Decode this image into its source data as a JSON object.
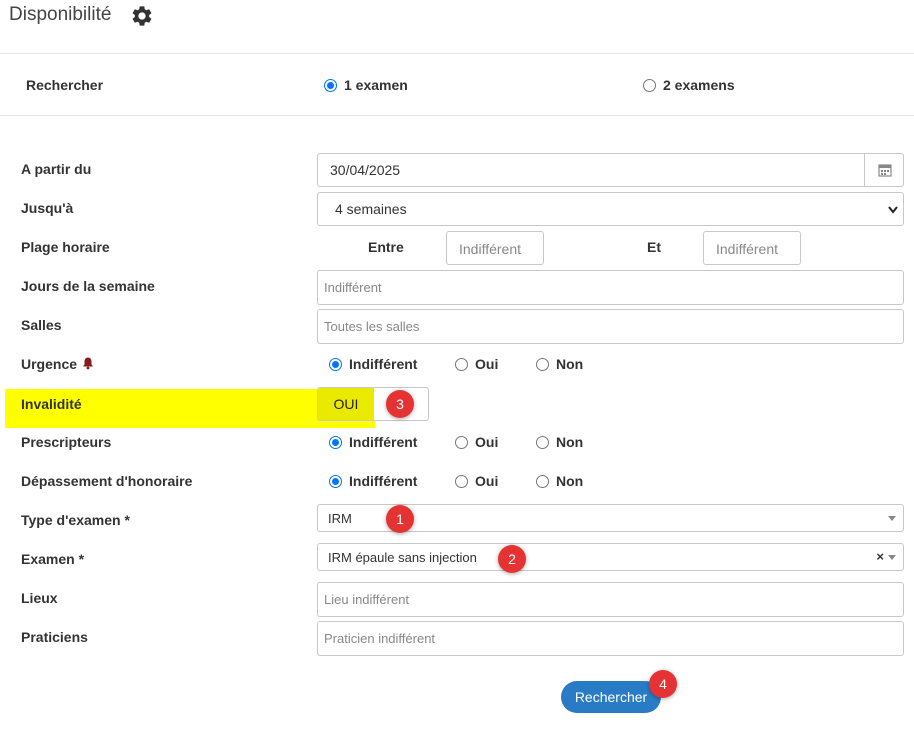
{
  "header": {
    "title": "Disponibilité",
    "settings_icon": "gear-icon"
  },
  "search_mode": {
    "label": "Rechercher",
    "options": [
      {
        "label": "1 examen",
        "checked": true
      },
      {
        "label": "2 examens",
        "checked": false
      }
    ]
  },
  "form": {
    "from": {
      "label": "A partir du",
      "value": "30/04/2025",
      "icon": "calendar-icon"
    },
    "until": {
      "label": "Jusqu'à",
      "value": "4 semaines"
    },
    "time_range": {
      "label": "Plage horaire",
      "start_label": "Entre",
      "start_placeholder": "Indifférent",
      "end_label": "Et",
      "end_placeholder": "Indifférent"
    },
    "weekdays": {
      "label": "Jours de la semaine",
      "placeholder": "Indifférent"
    },
    "rooms": {
      "label": "Salles",
      "placeholder": "Toutes les salles"
    },
    "urgency": {
      "label": "Urgence",
      "icon": "bell-icon",
      "options": [
        {
          "label": "Indifférent",
          "checked": true
        },
        {
          "label": "Oui",
          "checked": false
        },
        {
          "label": "Non",
          "checked": false
        }
      ]
    },
    "invalidity": {
      "label": "Invalidité",
      "toggle_label": "OUI"
    },
    "prescribers": {
      "label": "Prescripteurs",
      "options": [
        {
          "label": "Indifférent",
          "checked": true
        },
        {
          "label": "Oui",
          "checked": false
        },
        {
          "label": "Non",
          "checked": false
        }
      ]
    },
    "fee_overrun": {
      "label": "Dépassement d'honoraire",
      "options": [
        {
          "label": "Indifférent",
          "checked": true
        },
        {
          "label": "Oui",
          "checked": false
        },
        {
          "label": "Non",
          "checked": false
        }
      ]
    },
    "exam_type": {
      "label": "Type d'examen *",
      "value": "IRM"
    },
    "exam": {
      "label": "Examen *",
      "value": "IRM épaule sans injection",
      "clear": "×"
    },
    "places": {
      "label": "Lieux",
      "placeholder": "Lieu indifférent"
    },
    "practitioners": {
      "label": "Praticiens",
      "placeholder": "Praticien indifférent"
    }
  },
  "annotations": [
    "1",
    "2",
    "3",
    "4"
  ],
  "search_button": {
    "label": "Rechercher"
  },
  "colors": {
    "accent": "#2a7bc6",
    "highlight": "#ffff00",
    "badge": "#e53333",
    "bell": "#8b1a1a"
  }
}
